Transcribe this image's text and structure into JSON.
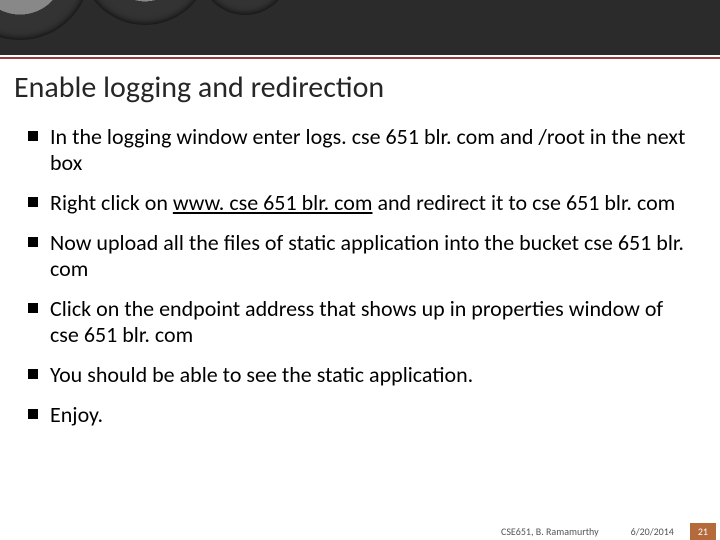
{
  "title": "Enable logging and redirection",
  "bullets": {
    "b0": "In the logging window enter logs. cse 651 blr. com and /root in the next box",
    "b1_pre": "Right click on ",
    "b1_link": "www. cse 651 blr. com",
    "b1_post": " and redirect it to cse 651 blr. com",
    "b2": "Now upload all the files of static application into the bucket cse 651 blr. com",
    "b3": "Click on the endpoint address that shows up in properties window of cse 651 blr. com",
    "b4": "You should be able to see the static application.",
    "b5": "Enjoy."
  },
  "footer": {
    "course": "CSE651, B. Ramamurthy",
    "date": "6/20/2014",
    "page": "21"
  }
}
